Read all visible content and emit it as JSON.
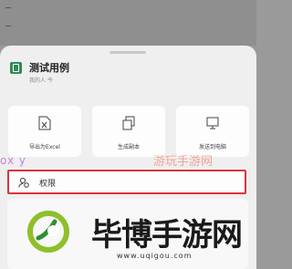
{
  "document": {
    "title": "测试用例",
    "subtitle": "我的人 今"
  },
  "actions": [
    {
      "label": "导出为Excel",
      "icon": "excel-export-icon"
    },
    {
      "label": "生成副本",
      "icon": "copy-icon"
    },
    {
      "label": "发送到电脑",
      "icon": "computer-icon"
    }
  ],
  "permission": {
    "label": "权限",
    "icon": "user-permission-icon",
    "highlight": "#d9343a"
  },
  "watermark": {
    "faint_text_left": "ox y",
    "faint_text_right": "游玩手游网",
    "brand": "毕博手游网",
    "url": "www.uqigou.com"
  }
}
